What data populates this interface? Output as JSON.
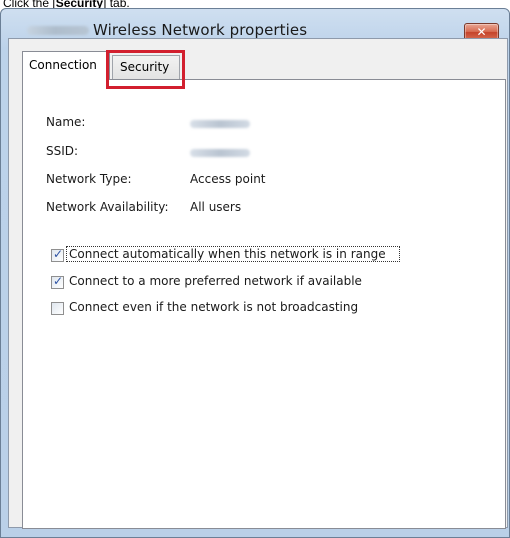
{
  "instruction": {
    "prefix": "Click the [",
    "bold": "Security",
    "suffix": "] tab."
  },
  "window": {
    "title": "Wireless Network properties",
    "close_glyph": "✕"
  },
  "tabs": [
    {
      "label": "Connection",
      "selected": true
    },
    {
      "label": "Security",
      "selected": false,
      "highlighted": true
    }
  ],
  "properties": {
    "name_label": "Name:",
    "ssid_label": "SSID:",
    "network_type_label": "Network Type:",
    "network_type_value": "Access point",
    "availability_label": "Network Availability:",
    "availability_value": "All users"
  },
  "options": [
    {
      "label": "Connect automatically when this network is in range",
      "checked": true
    },
    {
      "label": "Connect to a more preferred network if available",
      "checked": true
    },
    {
      "label": "Connect even if the network is not broadcasting",
      "checked": false
    }
  ],
  "colors": {
    "highlight": "#d21f2e",
    "close_button": "#d76a50",
    "checkmark": "#2d52a3"
  }
}
